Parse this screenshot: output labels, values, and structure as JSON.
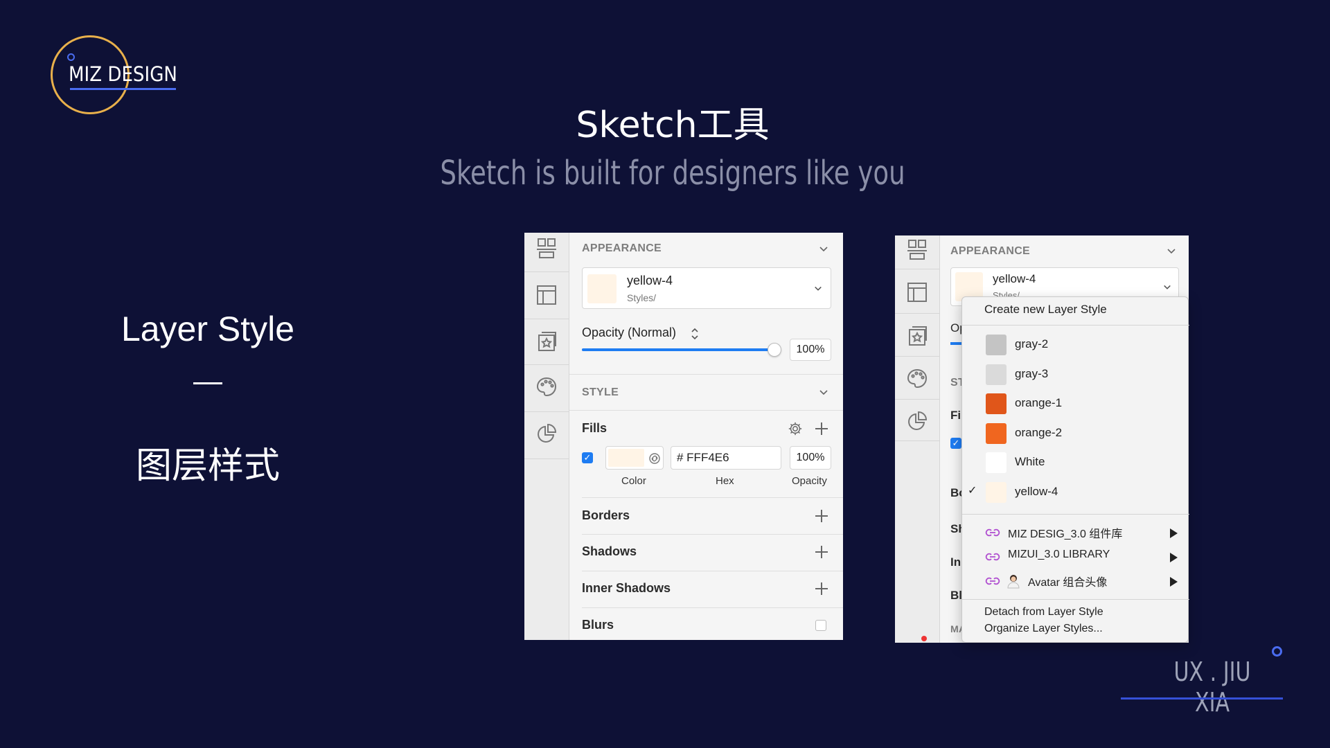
{
  "logo": {
    "text": "MIZ DESIGN"
  },
  "header": {
    "title": "Sketch工具",
    "subtitle": "Sketch is built for designers like you"
  },
  "left": {
    "title_en": "Layer Style",
    "dash": "—",
    "title_cn": "图层样式"
  },
  "footer": {
    "brand": "UX . JIU XIA"
  },
  "panel1": {
    "appearance_header": "APPEARANCE",
    "style_name": "yellow-4",
    "style_path": "Styles/",
    "opacity_label": "Opacity (Normal)",
    "opacity_value": "100%",
    "opacity_fraction": 1.0,
    "style_header": "STYLE",
    "fills_label": "Fills",
    "hex_value": "# FFF4E6",
    "fill_opacity": "100%",
    "color_caption": "Color",
    "hex_caption": "Hex",
    "opacity_caption": "Opacity",
    "borders": "Borders",
    "shadows": "Shadows",
    "inner_shadows": "Inner Shadows",
    "blurs": "Blurs",
    "swatch_color": "#fff4e6"
  },
  "panel2": {
    "appearance_header": "APPEARANCE",
    "style_name": "yellow-4",
    "style_path": "Styles/",
    "peek": {
      "op": "Op",
      "st": "ST",
      "fil": "Fil",
      "bo": "Bo",
      "sh": "Sh",
      "in": "Inı",
      "bl": "Bl",
      "ma": "MA"
    },
    "menu": {
      "create": "Create new Layer Style",
      "styles": [
        {
          "name": "gray-2",
          "color": "#c4c4c4",
          "checked": false
        },
        {
          "name": "gray-3",
          "color": "#dadada",
          "checked": false
        },
        {
          "name": "orange-1",
          "color": "#e0561a",
          "checked": false
        },
        {
          "name": "orange-2",
          "color": "#f0661f",
          "checked": false
        },
        {
          "name": "White",
          "color": "#ffffff",
          "checked": false
        },
        {
          "name": "yellow-4",
          "color": "#fff4e6",
          "checked": true
        }
      ],
      "check_mark": "✓",
      "libraries": [
        {
          "name": "MIZ DESIG_3.0 组件库"
        },
        {
          "name": "MIZUI_3.0 LIBRARY"
        },
        {
          "name": "Avatar 组合头像",
          "emoji": "🙍"
        }
      ],
      "detach": "Detach from Layer Style",
      "organize": "Organize Layer Styles..."
    }
  }
}
